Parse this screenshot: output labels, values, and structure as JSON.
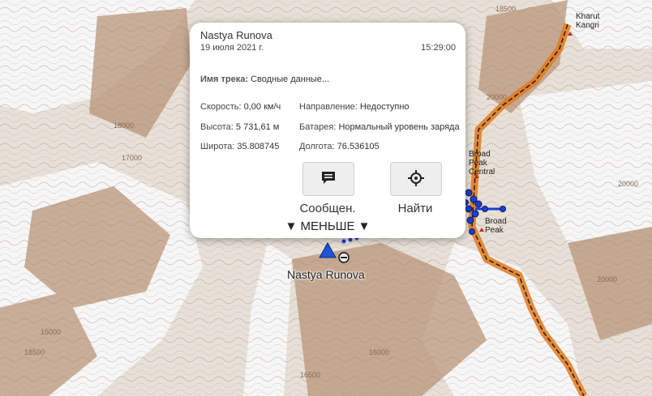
{
  "map": {
    "peaks": [
      {
        "name": "Kharut Kangri",
        "lines": [
          "Kharut",
          "Kangri"
        ]
      },
      {
        "name": "Broad Peak Central",
        "lines": [
          "Broad",
          "Peak",
          "Central"
        ]
      },
      {
        "name": "Broad Peak",
        "lines": [
          "Broad",
          "Peak"
        ]
      }
    ],
    "contour_labels": [
      "18500",
      "20000",
      "20000",
      "17000",
      "16000",
      "15000",
      "16500",
      "18500",
      "18000",
      "20000"
    ],
    "user_marker_label": "Nastya Runova",
    "colors": {
      "route": "#e07a1f",
      "track": "#1a3fd0",
      "marker": "#1f56d6"
    }
  },
  "popup": {
    "name": "Nastya Runova",
    "date": "19 июля 2021 г.",
    "time": "15:29:00",
    "track_label": "Имя трека:",
    "track_value": "Сводные данные...",
    "speed_label": "Скорость:",
    "speed_value": "0,00 км/ч",
    "direction_label": "Направление:",
    "direction_value": "Недоступно",
    "altitude_label": "Высота:",
    "altitude_value": "5 731,61 м",
    "battery_label": "Батарея:",
    "battery_value": "Нормальный уровень заряда",
    "latitude_label": "Широта:",
    "latitude_value": "35.808745",
    "longitude_label": "Долгота:",
    "longitude_value": "76.536105",
    "message_button": {
      "label": "Сообщен.",
      "icon": "message-icon"
    },
    "find_button": {
      "label": "Найти",
      "icon": "crosshair-icon"
    },
    "collapse_label": "▼ МЕНЬШЕ ▼"
  }
}
